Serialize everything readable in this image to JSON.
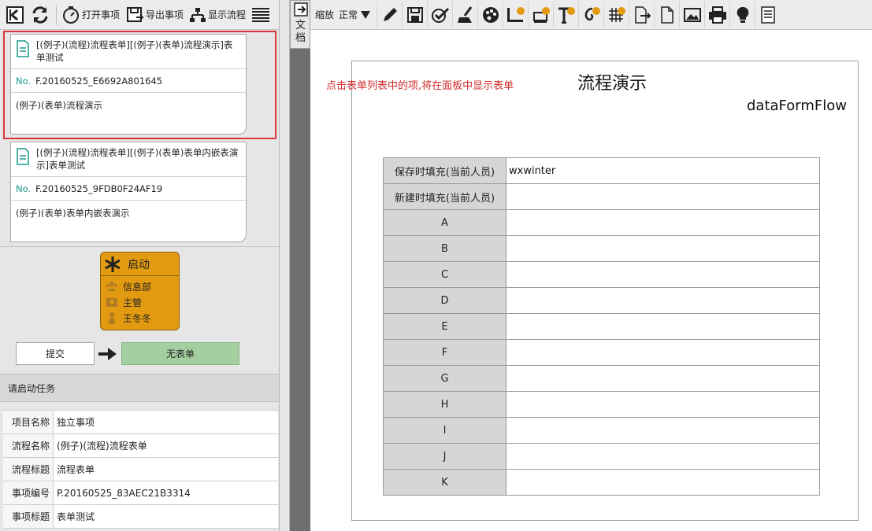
{
  "left_toolbar": {
    "open_label": "打开事项",
    "export_label": "导出事项",
    "show_flow_label": "显示流程"
  },
  "items": [
    {
      "title": "[(例子)(流程)流程表单][(例子)(表单)流程演示]表单测试",
      "no_prefix": "No.",
      "no": "F.20160525_E6692A801645",
      "desc": "(例子)(表单)流程演示"
    },
    {
      "title": "[(例子)(流程)流程表单][(例子)(表单)表单内嵌表演示]表单测试",
      "no_prefix": "No.",
      "no": "F.20160525_9FDB0F24AF19",
      "desc": "(例子)(表单)表单内嵌表演示"
    }
  ],
  "flow": {
    "title": "启动",
    "lines": [
      "信息部",
      "主管",
      "王冬冬"
    ],
    "submit_label": "提交",
    "noform_label": "无表单"
  },
  "status_text": "请启动任务",
  "props": [
    {
      "k": "项目名称",
      "v": "独立事项"
    },
    {
      "k": "流程名称",
      "v": "(例子)(流程)流程表单"
    },
    {
      "k": "流程标题",
      "v": "流程表单"
    },
    {
      "k": "事项编号",
      "v": "P.20160525_83AEC21B3314"
    },
    {
      "k": "事项标题",
      "v": "表单测试"
    }
  ],
  "strip_tab_label": "文档",
  "right_toolbar": {
    "zoom_label": "缩放",
    "zoom_value": "正常"
  },
  "form": {
    "hint": "点击表单列表中的项,将在面板中显示表单",
    "title": "流程演示",
    "subtitle": "dataFormFlow",
    "rows": [
      {
        "k": "保存时填充(当前人员)",
        "v": "wxwinter"
      },
      {
        "k": "新建时填充(当前人员)",
        "v": ""
      },
      {
        "k": "A",
        "v": ""
      },
      {
        "k": "B",
        "v": ""
      },
      {
        "k": "C",
        "v": ""
      },
      {
        "k": "D",
        "v": ""
      },
      {
        "k": "E",
        "v": ""
      },
      {
        "k": "F",
        "v": ""
      },
      {
        "k": "G",
        "v": ""
      },
      {
        "k": "H",
        "v": ""
      },
      {
        "k": "I",
        "v": ""
      },
      {
        "k": "J",
        "v": ""
      },
      {
        "k": "K",
        "v": ""
      }
    ]
  },
  "colors": {
    "accent_teal": "#1a9c8c",
    "selection_red": "#d9353b",
    "flow_orange": "#e29a11",
    "noform_green": "#a4cfa0",
    "hint_red": "#cf2b2b"
  }
}
